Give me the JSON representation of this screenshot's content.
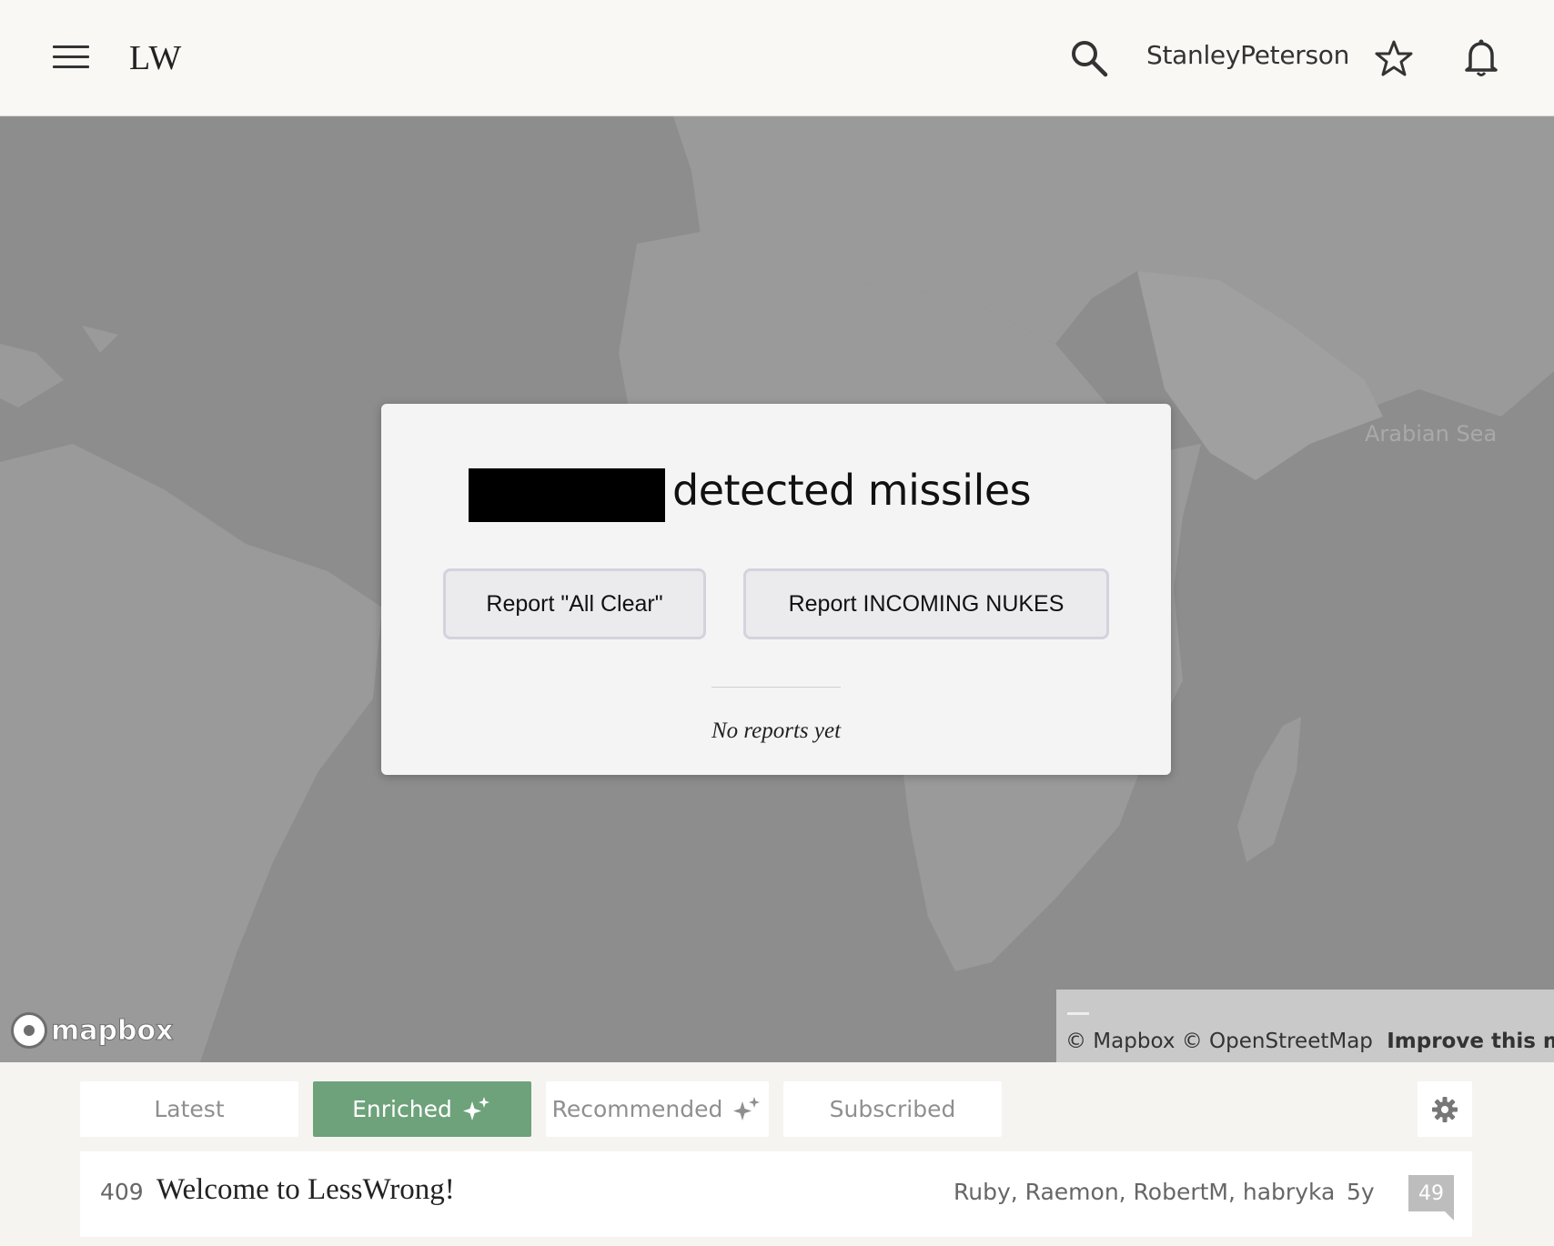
{
  "header": {
    "logo": "LW",
    "username": "StanleyPeterson"
  },
  "map": {
    "sea_label": "Arabian Sea",
    "brand": "mapbox",
    "attribution_text": "© Mapbox © OpenStreetMap",
    "improve_label": "Improve this map"
  },
  "modal": {
    "title": "detected missiles",
    "btn_clear": "Report \"All Clear\"",
    "btn_nukes": "Report INCOMING NUKES",
    "status": "No reports yet"
  },
  "tabs": [
    {
      "label": "Latest",
      "active": false
    },
    {
      "label": "Enriched",
      "active": true
    },
    {
      "label": "Recommended",
      "active": false
    },
    {
      "label": "Subscribed",
      "active": false
    }
  ],
  "post": {
    "score": "409",
    "title": "Welcome to LessWrong!",
    "authors": "Ruby, Raemon, RobertM, habryka",
    "age": "5y",
    "comments": "49"
  },
  "colors": {
    "accent": "#6da27b",
    "map": "#8d8d8d"
  }
}
